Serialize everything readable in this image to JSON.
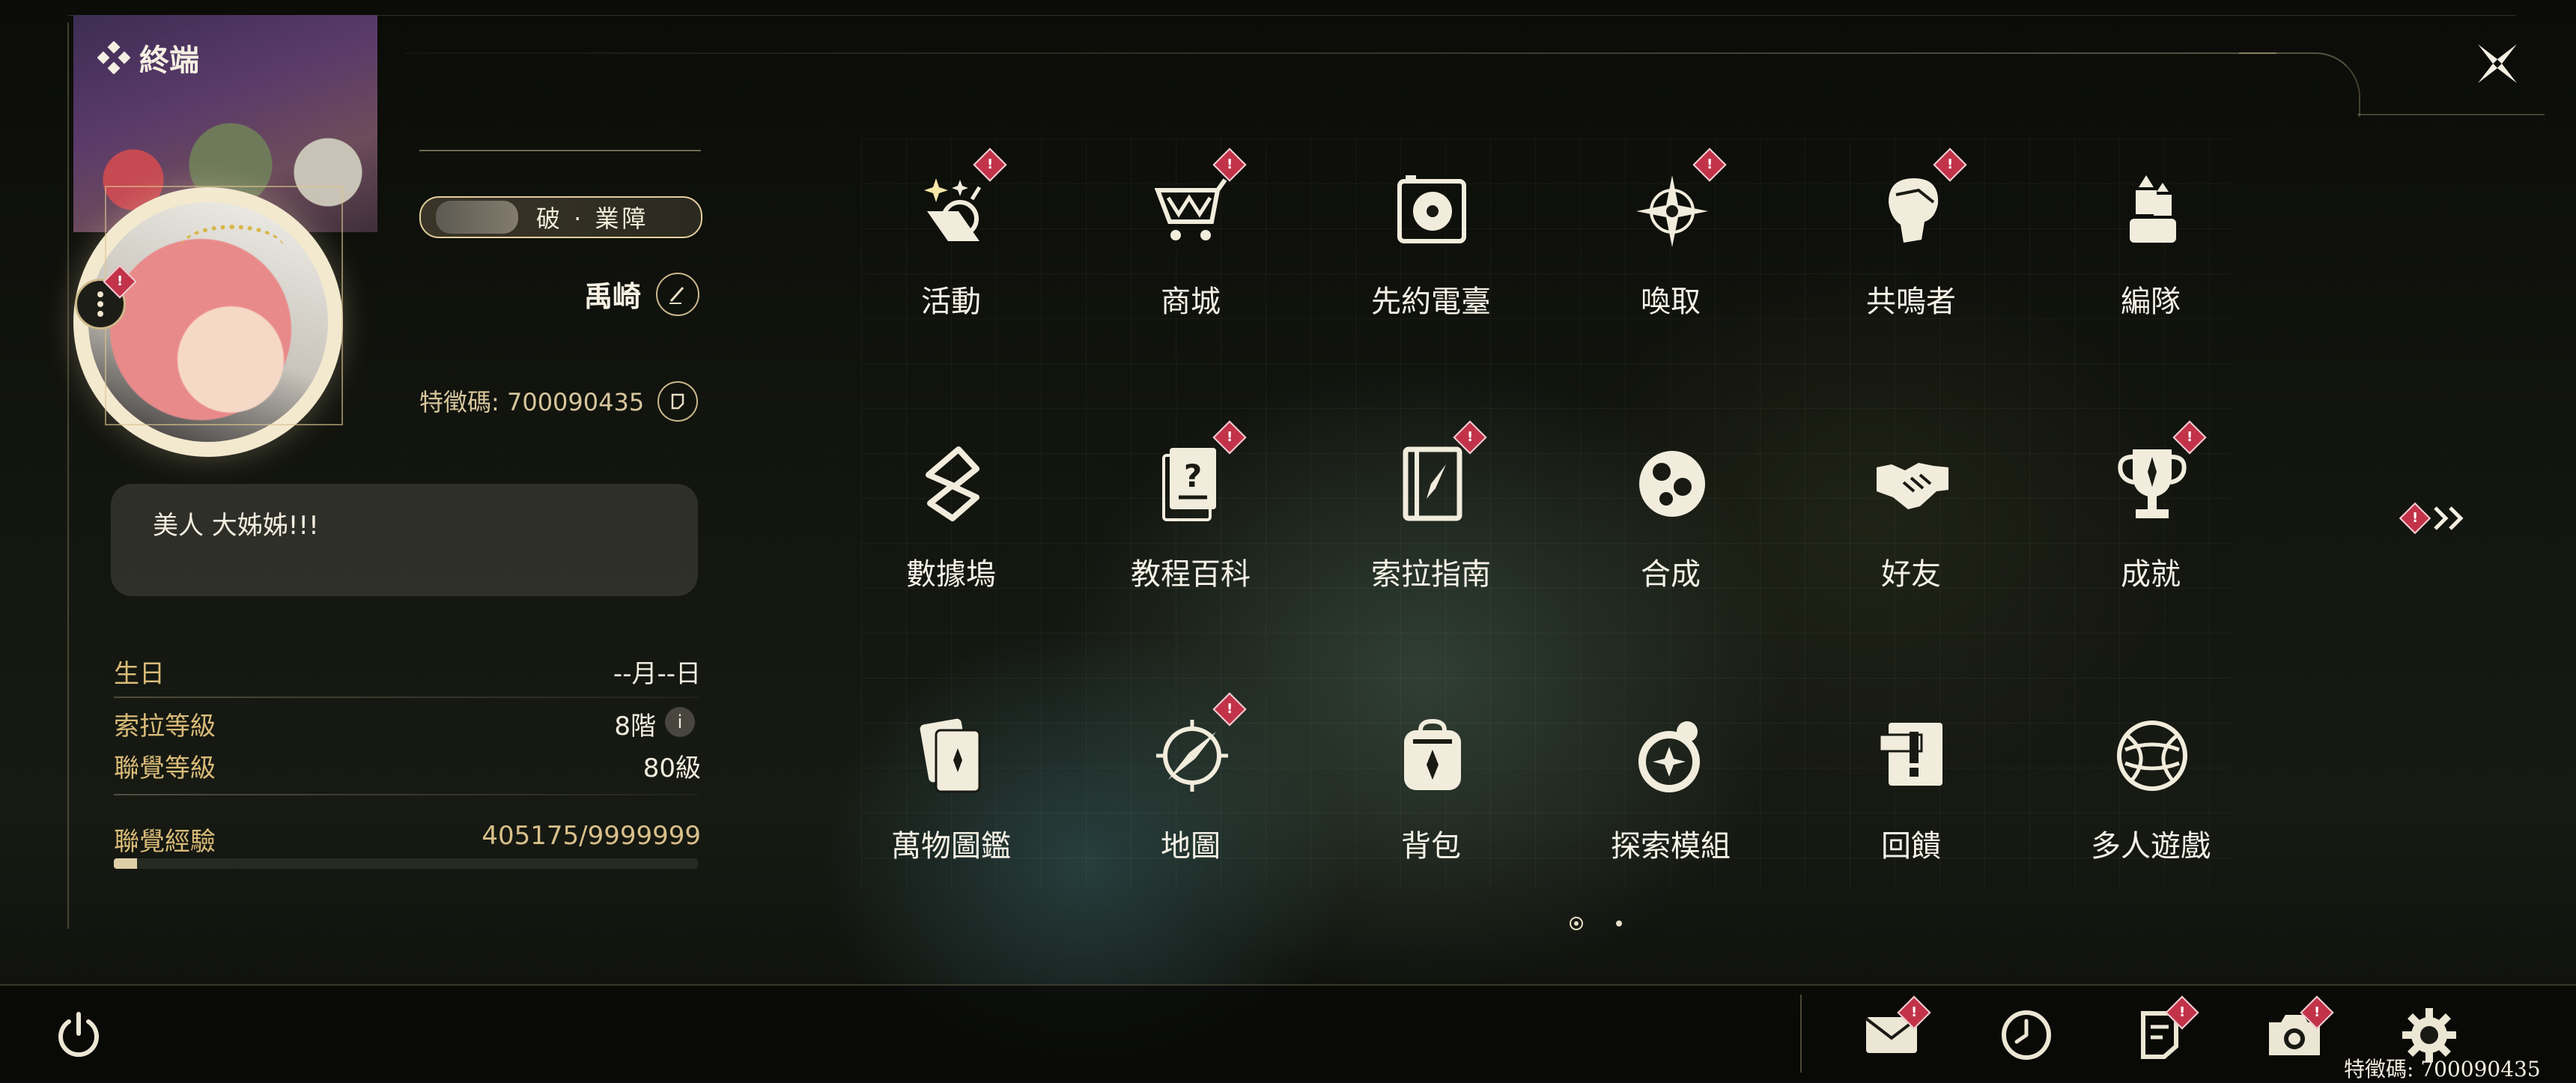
{
  "header": {
    "terminal_title": "終端",
    "close_icon": "close-x-icon"
  },
  "profile": {
    "title_badge": "破 · 業障",
    "name": "禹崎",
    "uid_label": "特徵碼:",
    "uid_value": "700090435",
    "signature": "美人 大姊姊!!!",
    "stats": {
      "birthday_label": "生日",
      "birthday_value": "--月--日",
      "sola_level_label": "索拉等級",
      "sola_level_value": "8階",
      "union_level_label": "聯覺等級",
      "union_level_value": "80級",
      "union_exp_label": "聯覺經驗",
      "union_exp_value": "405175/9999999",
      "union_exp_progress": 0.04
    }
  },
  "menu": {
    "items": [
      {
        "label": "活動",
        "icon": "sparkle-clock-icon",
        "alert": true
      },
      {
        "label": "商城",
        "icon": "shopping-cart-icon",
        "alert": true
      },
      {
        "label": "先約電臺",
        "icon": "turntable-icon",
        "alert": false
      },
      {
        "label": "喚取",
        "icon": "compass-star-icon",
        "alert": true
      },
      {
        "label": "共鳴者",
        "icon": "character-head-icon",
        "alert": true
      },
      {
        "label": "編隊",
        "icon": "team-formation-icon",
        "alert": false
      },
      {
        "label": "數據塢",
        "icon": "data-dock-icon",
        "alert": false
      },
      {
        "label": "教程百科",
        "icon": "tutorial-book-icon",
        "alert": true
      },
      {
        "label": "索拉指南",
        "icon": "guide-book-icon",
        "alert": true
      },
      {
        "label": "合成",
        "icon": "synthesis-icon",
        "alert": false
      },
      {
        "label": "好友",
        "icon": "handshake-icon",
        "alert": false
      },
      {
        "label": "成就",
        "icon": "trophy-icon",
        "alert": true
      },
      {
        "label": "萬物圖鑑",
        "icon": "card-catalog-icon",
        "alert": false
      },
      {
        "label": "地圖",
        "icon": "map-compass-icon",
        "alert": true
      },
      {
        "label": "背包",
        "icon": "backpack-icon",
        "alert": false
      },
      {
        "label": "探索模組",
        "icon": "explore-module-icon",
        "alert": false
      },
      {
        "label": "回饋",
        "icon": "feedback-icon",
        "alert": false
      },
      {
        "label": "多人遊戲",
        "icon": "multiplayer-globe-icon",
        "alert": false
      }
    ],
    "pages": 2,
    "current_page": 1
  },
  "bottom_bar": {
    "icons": [
      {
        "name": "mail-icon",
        "alert": true
      },
      {
        "name": "clock-icon",
        "alert": false
      },
      {
        "name": "notice-icon",
        "alert": true
      },
      {
        "name": "camera-icon",
        "alert": true
      },
      {
        "name": "settings-gear-icon",
        "alert": false
      }
    ],
    "uid_text": "特徵碼: 700090435"
  },
  "colors": {
    "accent_gold": "#d9bb78",
    "alert_red": "#c2334a",
    "text_light": "#f5f1e6"
  }
}
